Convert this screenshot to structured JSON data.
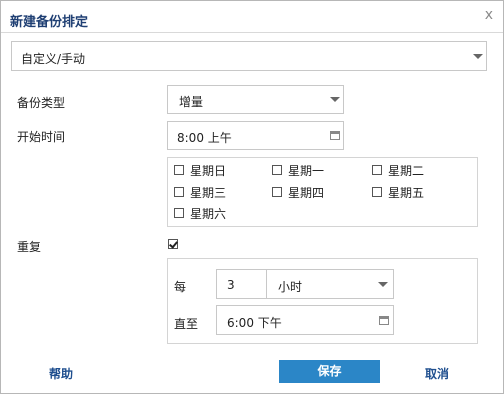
{
  "dialog": {
    "title": "新建备份排定",
    "close_glyph": "x"
  },
  "schedule_type": {
    "value": "自定义/手动"
  },
  "backup_type": {
    "label": "备份类型",
    "value": "增量"
  },
  "start_time": {
    "label": "开始时间",
    "value": "8:00 上午"
  },
  "days": [
    {
      "label": "星期日",
      "checked": false
    },
    {
      "label": "星期一",
      "checked": false
    },
    {
      "label": "星期二",
      "checked": false
    },
    {
      "label": "星期三",
      "checked": false
    },
    {
      "label": "星期四",
      "checked": false
    },
    {
      "label": "星期五",
      "checked": false
    },
    {
      "label": "星期六",
      "checked": false
    }
  ],
  "repeat": {
    "label": "重复",
    "checked": true,
    "every_label": "每",
    "every_value": "3",
    "unit_value": "小时",
    "until_label": "直至",
    "until_value": "6:00 下午"
  },
  "footer": {
    "help_label": "帮助",
    "save_label": "保存",
    "cancel_label": "取消"
  },
  "colors": {
    "accent": "#2b86c7",
    "title": "#1f3f73",
    "link": "#1f4f8f"
  },
  "icons": {
    "close": "close-icon",
    "dropdown": "chevron-down-icon",
    "calendar": "calendar-icon",
    "checkbox": "checkbox-icon"
  }
}
